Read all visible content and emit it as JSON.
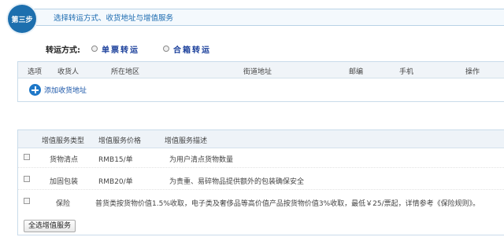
{
  "step": {
    "badge": "第三步",
    "title": "选择转运方式、收货地址与增值服务"
  },
  "transport": {
    "label": "转运方式:",
    "options": [
      {
        "label": "单票转运",
        "selected": false
      },
      {
        "label": "合箱转运",
        "selected": false
      }
    ]
  },
  "address_table": {
    "columns": [
      "选项",
      "收货人",
      "所在地区",
      "街道地址",
      "邮编",
      "手机",
      "操作"
    ],
    "add_label": "添加收货地址"
  },
  "services_table": {
    "columns": [
      "增值服务类型",
      "增值服务价格",
      "增值服务描述"
    ],
    "rows": [
      {
        "type": "货物清点",
        "price": "RMB15/单",
        "desc": "为用户清点货物数量"
      },
      {
        "type": "加固包装",
        "price": "RMB20/单",
        "desc": "为贵重、易碎物品提供额外的包装确保安全"
      },
      {
        "type": "保险",
        "price": "",
        "desc": "普货类按货物价值1.5%收取，电子类及奢侈品等高价值产品按货物价值3%收取，最低￥25/票起，详情参考",
        "link": "《保险规则》",
        "tail": "。"
      }
    ],
    "select_all_label": "全选增值服务"
  },
  "colors": {
    "accent": "#1d6fae",
    "link": "#1a55a8",
    "header_bg": "#f0f4f8"
  }
}
